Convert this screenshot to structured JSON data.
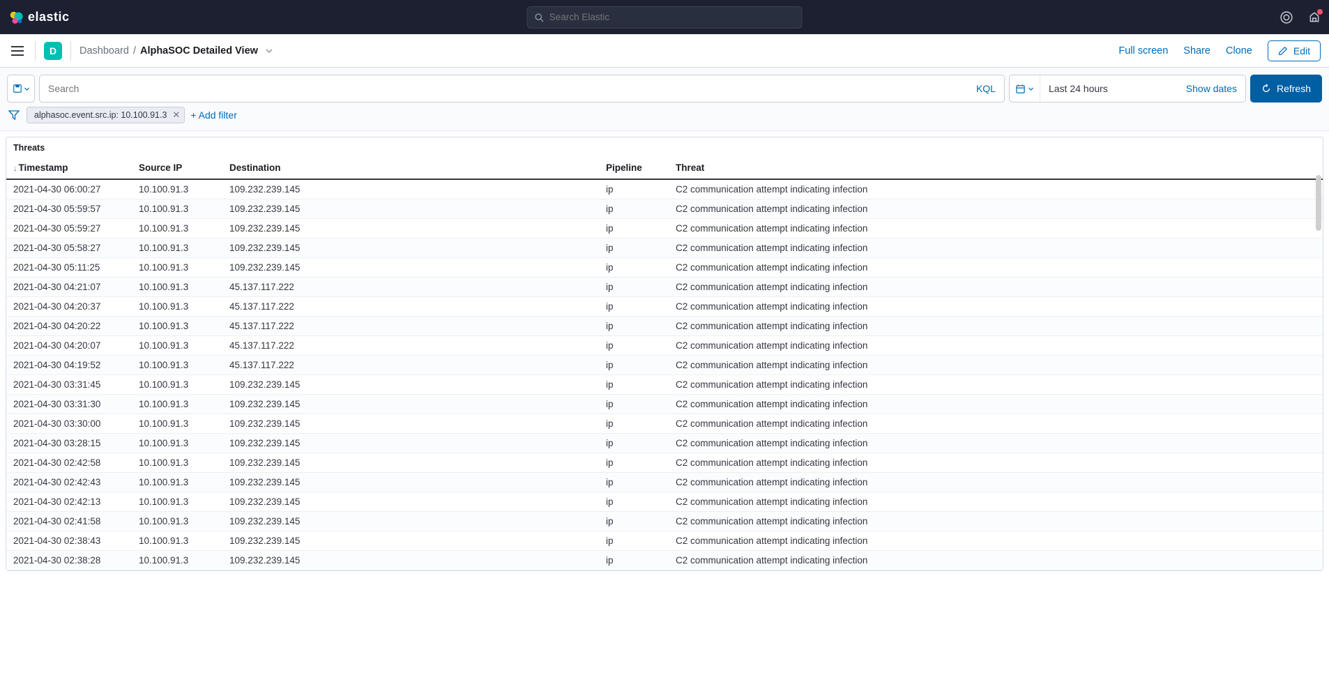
{
  "global_search_placeholder": "Search Elastic",
  "logo_text": "elastic",
  "space_letter": "D",
  "breadcrumb": {
    "root": "Dashboard",
    "current": "AlphaSOC Detailed View"
  },
  "actions": {
    "full_screen": "Full screen",
    "share": "Share",
    "clone": "Clone",
    "edit": "Edit"
  },
  "query": {
    "search_placeholder": "Search",
    "kql": "KQL",
    "date_label": "Last 24 hours",
    "show_dates": "Show dates",
    "refresh": "Refresh"
  },
  "filter": {
    "pill": "alphasoc.event.src.ip: 10.100.91.3",
    "add_filter": "+ Add filter"
  },
  "panel_title": "Threats",
  "columns": {
    "timestamp": "Timestamp",
    "source_ip": "Source IP",
    "destination": "Destination",
    "pipeline": "Pipeline",
    "threat": "Threat"
  },
  "rows": [
    {
      "ts": "2021-04-30 06:00:27",
      "src": "10.100.91.3",
      "dst": "109.232.239.145",
      "pipe": "ip",
      "threat": "C2 communication attempt indicating infection"
    },
    {
      "ts": "2021-04-30 05:59:57",
      "src": "10.100.91.3",
      "dst": "109.232.239.145",
      "pipe": "ip",
      "threat": "C2 communication attempt indicating infection"
    },
    {
      "ts": "2021-04-30 05:59:27",
      "src": "10.100.91.3",
      "dst": "109.232.239.145",
      "pipe": "ip",
      "threat": "C2 communication attempt indicating infection"
    },
    {
      "ts": "2021-04-30 05:58:27",
      "src": "10.100.91.3",
      "dst": "109.232.239.145",
      "pipe": "ip",
      "threat": "C2 communication attempt indicating infection"
    },
    {
      "ts": "2021-04-30 05:11:25",
      "src": "10.100.91.3",
      "dst": "109.232.239.145",
      "pipe": "ip",
      "threat": "C2 communication attempt indicating infection"
    },
    {
      "ts": "2021-04-30 04:21:07",
      "src": "10.100.91.3",
      "dst": "45.137.117.222",
      "pipe": "ip",
      "threat": "C2 communication attempt indicating infection"
    },
    {
      "ts": "2021-04-30 04:20:37",
      "src": "10.100.91.3",
      "dst": "45.137.117.222",
      "pipe": "ip",
      "threat": "C2 communication attempt indicating infection"
    },
    {
      "ts": "2021-04-30 04:20:22",
      "src": "10.100.91.3",
      "dst": "45.137.117.222",
      "pipe": "ip",
      "threat": "C2 communication attempt indicating infection"
    },
    {
      "ts": "2021-04-30 04:20:07",
      "src": "10.100.91.3",
      "dst": "45.137.117.222",
      "pipe": "ip",
      "threat": "C2 communication attempt indicating infection"
    },
    {
      "ts": "2021-04-30 04:19:52",
      "src": "10.100.91.3",
      "dst": "45.137.117.222",
      "pipe": "ip",
      "threat": "C2 communication attempt indicating infection"
    },
    {
      "ts": "2021-04-30 03:31:45",
      "src": "10.100.91.3",
      "dst": "109.232.239.145",
      "pipe": "ip",
      "threat": "C2 communication attempt indicating infection"
    },
    {
      "ts": "2021-04-30 03:31:30",
      "src": "10.100.91.3",
      "dst": "109.232.239.145",
      "pipe": "ip",
      "threat": "C2 communication attempt indicating infection"
    },
    {
      "ts": "2021-04-30 03:30:00",
      "src": "10.100.91.3",
      "dst": "109.232.239.145",
      "pipe": "ip",
      "threat": "C2 communication attempt indicating infection"
    },
    {
      "ts": "2021-04-30 03:28:15",
      "src": "10.100.91.3",
      "dst": "109.232.239.145",
      "pipe": "ip",
      "threat": "C2 communication attempt indicating infection"
    },
    {
      "ts": "2021-04-30 02:42:58",
      "src": "10.100.91.3",
      "dst": "109.232.239.145",
      "pipe": "ip",
      "threat": "C2 communication attempt indicating infection"
    },
    {
      "ts": "2021-04-30 02:42:43",
      "src": "10.100.91.3",
      "dst": "109.232.239.145",
      "pipe": "ip",
      "threat": "C2 communication attempt indicating infection"
    },
    {
      "ts": "2021-04-30 02:42:13",
      "src": "10.100.91.3",
      "dst": "109.232.239.145",
      "pipe": "ip",
      "threat": "C2 communication attempt indicating infection"
    },
    {
      "ts": "2021-04-30 02:41:58",
      "src": "10.100.91.3",
      "dst": "109.232.239.145",
      "pipe": "ip",
      "threat": "C2 communication attempt indicating infection"
    },
    {
      "ts": "2021-04-30 02:38:43",
      "src": "10.100.91.3",
      "dst": "109.232.239.145",
      "pipe": "ip",
      "threat": "C2 communication attempt indicating infection"
    },
    {
      "ts": "2021-04-30 02:38:28",
      "src": "10.100.91.3",
      "dst": "109.232.239.145",
      "pipe": "ip",
      "threat": "C2 communication attempt indicating infection"
    }
  ]
}
